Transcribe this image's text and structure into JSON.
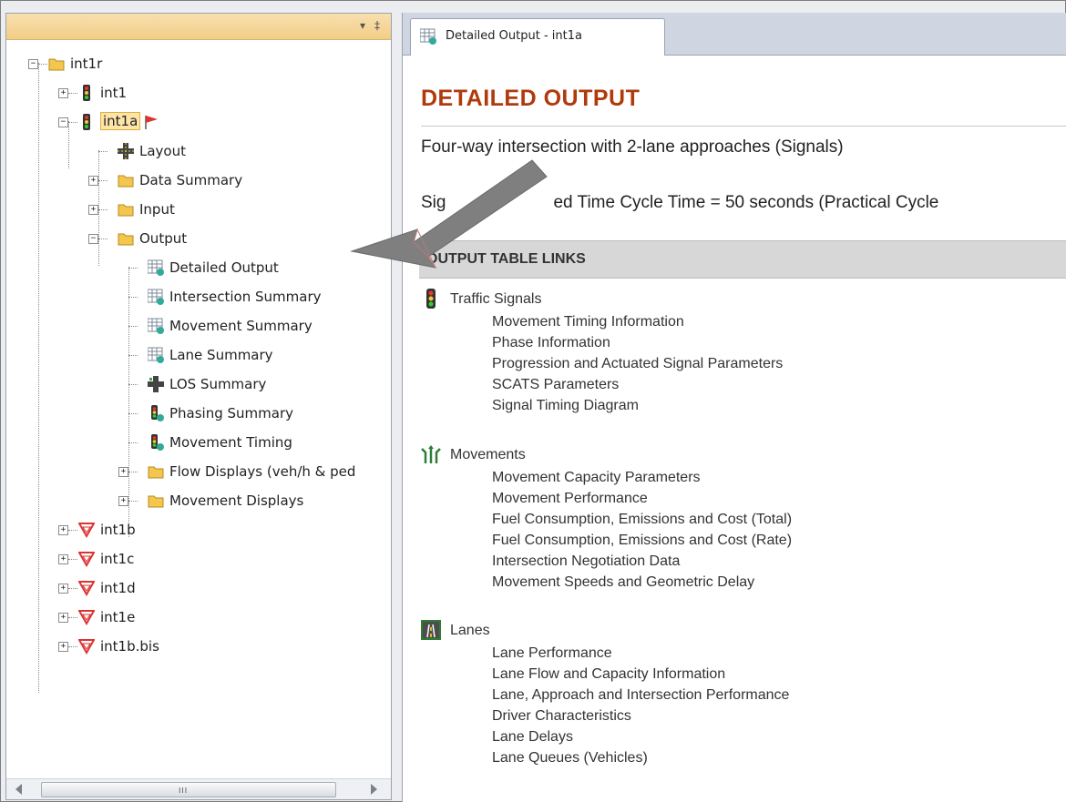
{
  "colors": {
    "title": "#b03a0c",
    "selection": "#fde5a8",
    "header_panel": "#f2cd86"
  },
  "left_panel": {
    "header": {
      "controls": [
        "▾",
        "‡"
      ]
    },
    "tree": {
      "root": "int1r",
      "int1": "int1",
      "int1a": "int1a",
      "layout": "Layout",
      "data_summary": "Data Summary",
      "input": "Input",
      "output": "Output",
      "detailed_output": "Detailed Output",
      "intersection_summary": "Intersection Summary",
      "movement_summary": "Movement Summary",
      "lane_summary": "Lane Summary",
      "los_summary": "LOS Summary",
      "phasing_summary": "Phasing Summary",
      "movement_timing": "Movement Timing",
      "flow_displays": "Flow Displays (veh/h & ped",
      "movement_displays": "Movement Displays",
      "int1b": "int1b",
      "int1c": "int1c",
      "int1d": "int1d",
      "int1e": "int1e",
      "int1b_bis": "int1b.bis"
    },
    "scrollbar": {
      "grip": "III"
    }
  },
  "tab": {
    "label": "Detailed Output - int1a",
    "icon": "table-icon"
  },
  "document": {
    "title": "DETAILED OUTPUT",
    "subtitle": "Four-way intersection with 2-lane approaches (Signals)",
    "line_left": "Sig",
    "line_right": "ed Time   Cycle Time = 50 seconds (Practical Cycle",
    "links_header": "OUTPUT TABLE LINKS",
    "sections": [
      {
        "label": "Traffic Signals",
        "icon": "traffic-light-icon",
        "items": [
          "Movement Timing Information",
          "Phase Information",
          "Progression and Actuated Signal Parameters",
          "SCATS Parameters",
          "Signal Timing Diagram"
        ]
      },
      {
        "label": "Movements",
        "icon": "movements-icon",
        "items": [
          "Movement Capacity Parameters",
          "Movement Performance",
          "Fuel Consumption, Emissions and Cost (Total)",
          "Fuel Consumption, Emissions and Cost (Rate)",
          "Intersection Negotiation Data",
          "Movement Speeds and Geometric Delay"
        ]
      },
      {
        "label": "Lanes",
        "icon": "lanes-icon",
        "items": [
          "Lane Performance",
          "Lane Flow and Capacity Information",
          "Lane, Approach and Intersection Performance",
          "Driver Characteristics",
          "Lane Delays",
          "Lane Queues (Vehicles)"
        ]
      }
    ]
  }
}
